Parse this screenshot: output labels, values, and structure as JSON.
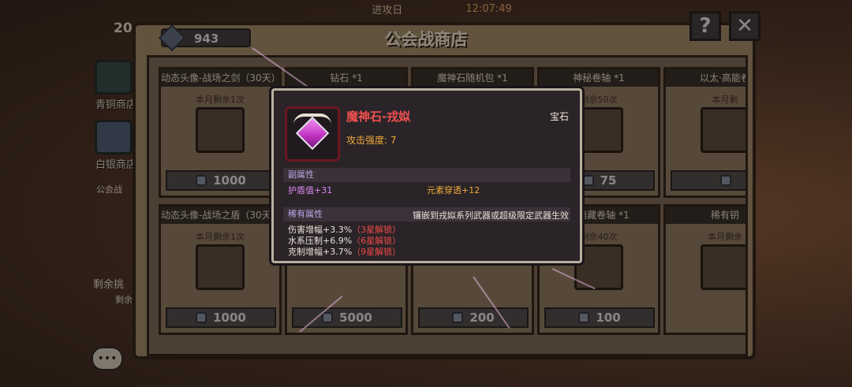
{
  "top_bar": {
    "mode_label": "进攻日",
    "clock": "12:07:49"
  },
  "left": {
    "counter": "20",
    "tabs": [
      {
        "label": "青铜商店",
        "icon": "bronze-shop-icon"
      },
      {
        "label": "白银商店",
        "icon": "silver-shop-icon"
      }
    ],
    "sub_label": "公会战",
    "remain_label": "剩余挑",
    "remain_label2": "剩余"
  },
  "shop": {
    "title": "公会战商店",
    "currency": {
      "icon": "guild-coin-icon",
      "value": "943"
    },
    "help_label": "?",
    "close_label": "✕",
    "cards": [
      {
        "name": "动态头像-战场之剑（30天）*1",
        "remain": "本月剩余1次",
        "price": "1000"
      },
      {
        "name": "钻石 *1",
        "remain": "",
        "price": ""
      },
      {
        "name": "魔神石随机包 *1",
        "remain": "",
        "price": ""
      },
      {
        "name": "神秘卷轴 *1",
        "remain": "剩余50次",
        "price": "75"
      },
      {
        "name": "以太·高能卷",
        "remain": "本月剩",
        "price": ""
      },
      {
        "name": "动态头像-战场之盾（30天）*1",
        "remain": "本月剩余1次",
        "price": "1000"
      },
      {
        "name": "",
        "remain": "",
        "price": "5000"
      },
      {
        "name": "",
        "remain": "",
        "price": "200"
      },
      {
        "name": "院典藏卷轴 *1",
        "remain": "剩余40次",
        "price": "100"
      },
      {
        "name": "稀有钥",
        "remain": "本月剩余",
        "price": ""
      }
    ]
  },
  "tooltip": {
    "name": "魔神石-戎姒",
    "type": "宝石",
    "attack": "攻击强度: 7",
    "secondary_header": "副属性",
    "secondary": [
      {
        "text": "护盾值+31"
      },
      {
        "text": "元素穿透+12"
      }
    ],
    "rare_header": "稀有属性",
    "rare_note": "镶嵌到戎姒系列武器或超级限定武器生效",
    "rare": [
      {
        "text": "伤害增幅+3.3%",
        "lock": "（3星解锁）"
      },
      {
        "text": "水系压制+6.9%",
        "lock": "（6星解锁）"
      },
      {
        "text": "克制增幅+3.7%",
        "lock": "（9星解锁）"
      }
    ]
  },
  "colors": {
    "tooltip_name": "#f05050",
    "attack": "#f0a838",
    "secondary_purple": "#d888f0",
    "lock_red": "#f04848"
  }
}
